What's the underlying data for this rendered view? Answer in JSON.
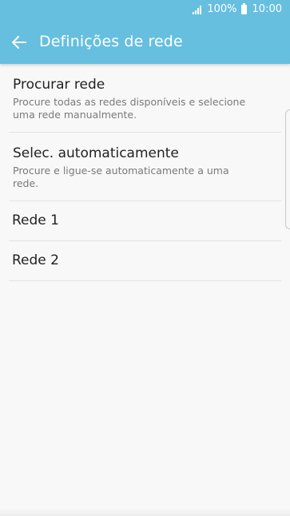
{
  "status_bar": {
    "battery_text": "100%",
    "time": "10:00",
    "icons": [
      "signal-icon",
      "battery-icon"
    ]
  },
  "header": {
    "title": "Definições de rede",
    "back_icon": "arrow-left-icon"
  },
  "colors": {
    "accent": "#66bfdf",
    "background": "#f8f8f8",
    "title_text": "#222222",
    "secondary_text": "#7a7a7a"
  },
  "list": {
    "items": [
      {
        "title": "Procurar rede",
        "subtitle": "Procure todas as redes disponíveis e selecione uma rede manualmente."
      },
      {
        "title": "Selec. automaticamente",
        "subtitle": "Procure e ligue-se automaticamente a uma rede."
      },
      {
        "title": "Rede 1"
      },
      {
        "title": "Rede 2"
      }
    ]
  }
}
